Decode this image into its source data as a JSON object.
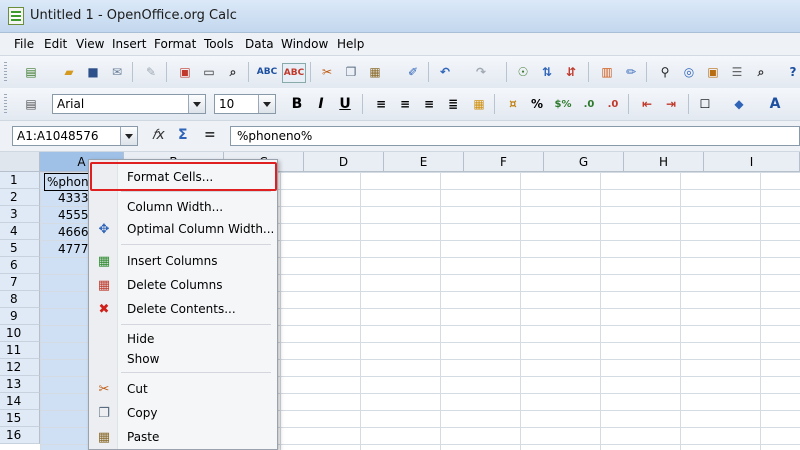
{
  "window": {
    "title": "Untitled 1 - OpenOffice.org Calc"
  },
  "menu": [
    "File",
    "Edit",
    "View",
    "Insert",
    "Format",
    "Tools",
    "Data",
    "Window",
    "Help"
  ],
  "format_toolbar": {
    "font_name": "Arial",
    "font_size": "10"
  },
  "formula_bar": {
    "name_box": "A1:A1048576",
    "content": "%phoneno%"
  },
  "columns": [
    "A",
    "B",
    "C",
    "D",
    "E",
    "F",
    "G",
    "H",
    "I"
  ],
  "rows": [
    "1",
    "2",
    "3",
    "4",
    "5",
    "6",
    "7",
    "8",
    "9",
    "10",
    "11",
    "12",
    "13",
    "14",
    "15",
    "16"
  ],
  "cells": [
    "%phone",
    "4333",
    "4555",
    "4666",
    "4777"
  ],
  "context_menu": {
    "format_cells": "Format Cells...",
    "column_width": "Column Width...",
    "optimal_column_width": "Optimal Column Width...",
    "insert_columns": "Insert Columns",
    "delete_columns": "Delete Columns",
    "delete_contents": "Delete Contents...",
    "hide": "Hide",
    "show": "Show",
    "cut": "Cut",
    "copy": "Copy",
    "paste": "Paste"
  },
  "colors": {
    "highlight": "#e02020",
    "selection": "#cfe0f4"
  }
}
